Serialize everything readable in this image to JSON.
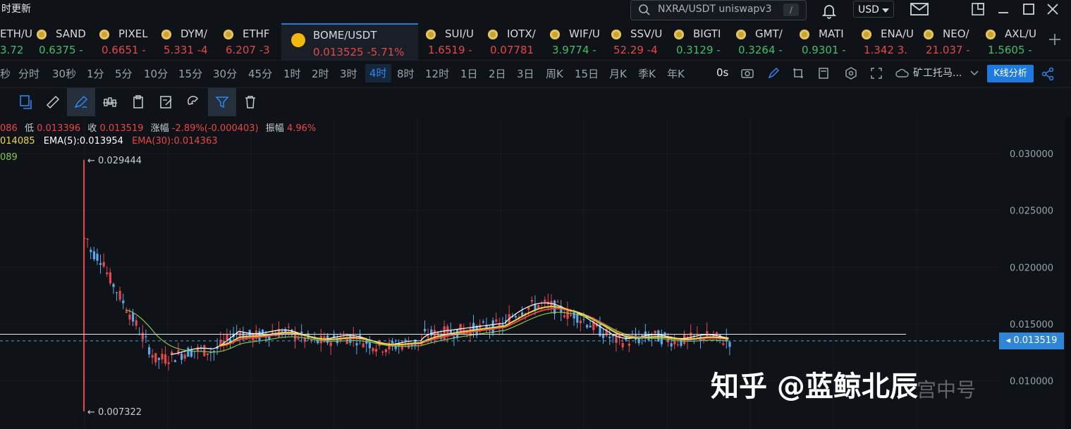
{
  "window": {
    "title": "时更新"
  },
  "search": {
    "text": "NXRA/USDT uniswapv3",
    "shortcut": "/"
  },
  "currency": {
    "selected": "USD"
  },
  "tabs": [
    {
      "symbol": "ETH/U",
      "price": "3.72",
      "dir": "up"
    },
    {
      "symbol": "SAND",
      "price": "0.6375 -",
      "dir": "up"
    },
    {
      "symbol": "PIXEL",
      "price": "0.6651 -",
      "dir": "dn"
    },
    {
      "symbol": "DYM/",
      "price": "5.331 -4",
      "dir": "dn"
    },
    {
      "symbol": "ETHF",
      "price": "6.207 -3",
      "dir": "dn"
    },
    {
      "symbol": "BOME/USDT",
      "price": "0.013525  -5.71%",
      "dir": "dn",
      "active": true
    },
    {
      "symbol": "SUI/U",
      "price": "1.6519 -",
      "dir": "dn"
    },
    {
      "symbol": "IOTX/",
      "price": "0.07781",
      "dir": "dn"
    },
    {
      "symbol": "WIF/U",
      "price": "3.9774 -",
      "dir": "up"
    },
    {
      "symbol": "SSV/U",
      "price": "52.29 -4",
      "dir": "dn"
    },
    {
      "symbol": "BIGTI",
      "price": "0.3129 -",
      "dir": "up"
    },
    {
      "symbol": "GMT/",
      "price": "0.3264 -",
      "dir": "up"
    },
    {
      "symbol": "MATI",
      "price": "0.9301 -",
      "dir": "up"
    },
    {
      "symbol": "ENA/U",
      "price": "1.342 3.",
      "dir": "dn"
    },
    {
      "symbol": "NEO/",
      "price": "21.037 -",
      "dir": "dn"
    },
    {
      "symbol": "AXL/U",
      "price": "1.5605 -",
      "dir": "up"
    }
  ],
  "periods": [
    "秒",
    "分时",
    "30秒",
    "1分",
    "5分",
    "10分",
    "15分",
    "30分",
    "45分",
    "1时",
    "2时",
    "3时",
    "4时",
    "8时",
    "12时",
    "1日",
    "2日",
    "3日",
    "周K",
    "15日",
    "月K",
    "季K",
    "年K"
  ],
  "active_period": "4时",
  "toolbar": {
    "timer": "0s",
    "miner_label": "矿工托马...",
    "kline_button": "K线分析"
  },
  "ohlc": {
    "high_partial": "086",
    "low_label": "低",
    "low": "0.013396",
    "close_label": "收",
    "close": "0.013519",
    "change_label": "涨幅",
    "change": "-2.89%(-0.000403)",
    "amp_label": "振幅",
    "amp": "4.96%"
  },
  "indicators": {
    "ema_a_partial": "014085",
    "ema5": "EMA(5):0.013954",
    "ema30": "EMA(30):0.014363",
    "ema_c_partial": "089"
  },
  "price_axis": [
    "0.030000",
    "0.025000",
    "0.020000",
    "0.015000",
    "0.010000"
  ],
  "current_price": "0.013519",
  "annotations": {
    "high": "← 0.029444",
    "low": "← 0.007322"
  },
  "watermark": {
    "main": "知乎 @蓝鲸北辰",
    "sub": "宫中号"
  },
  "colors": {
    "up": "#3fbf6a",
    "down": "#e5474b",
    "accent": "#1f7ae0"
  }
}
